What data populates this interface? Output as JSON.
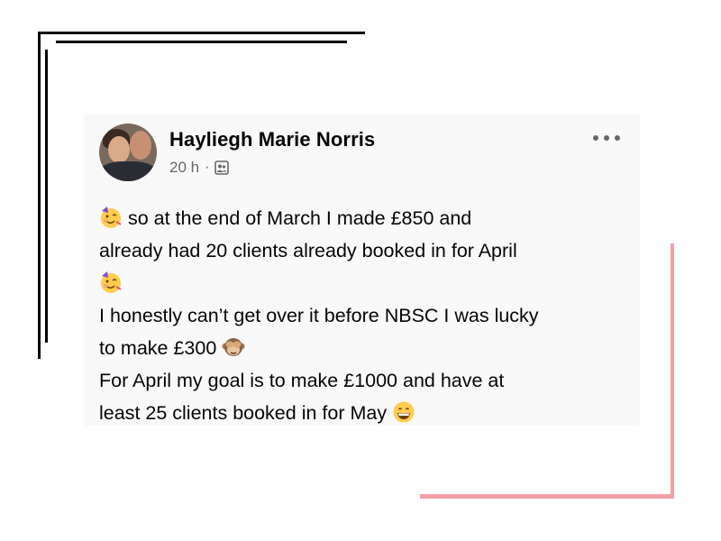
{
  "post": {
    "author": "Hayliegh Marie Norris",
    "time": "20 h",
    "separator": "·",
    "audience_icon": "friends-audience-icon",
    "more_icon": "more-options-icon",
    "lines": [
      "so at the end of March I made £850 and",
      "already had 20 clients already booked in for April",
      "I honestly can’t get over it before NBSC I was lucky",
      "to make £300",
      "For April my goal is to make £1000 and have at",
      "least 25 clients booked in for May"
    ],
    "emojis": [
      "partying-face",
      "partying-face",
      "see-no-evil-monkey",
      "grinning-face"
    ]
  },
  "decor": {
    "frame_color": "#000000",
    "accent_color": "#f4a0a8",
    "card_background": "#f9f9f9"
  }
}
